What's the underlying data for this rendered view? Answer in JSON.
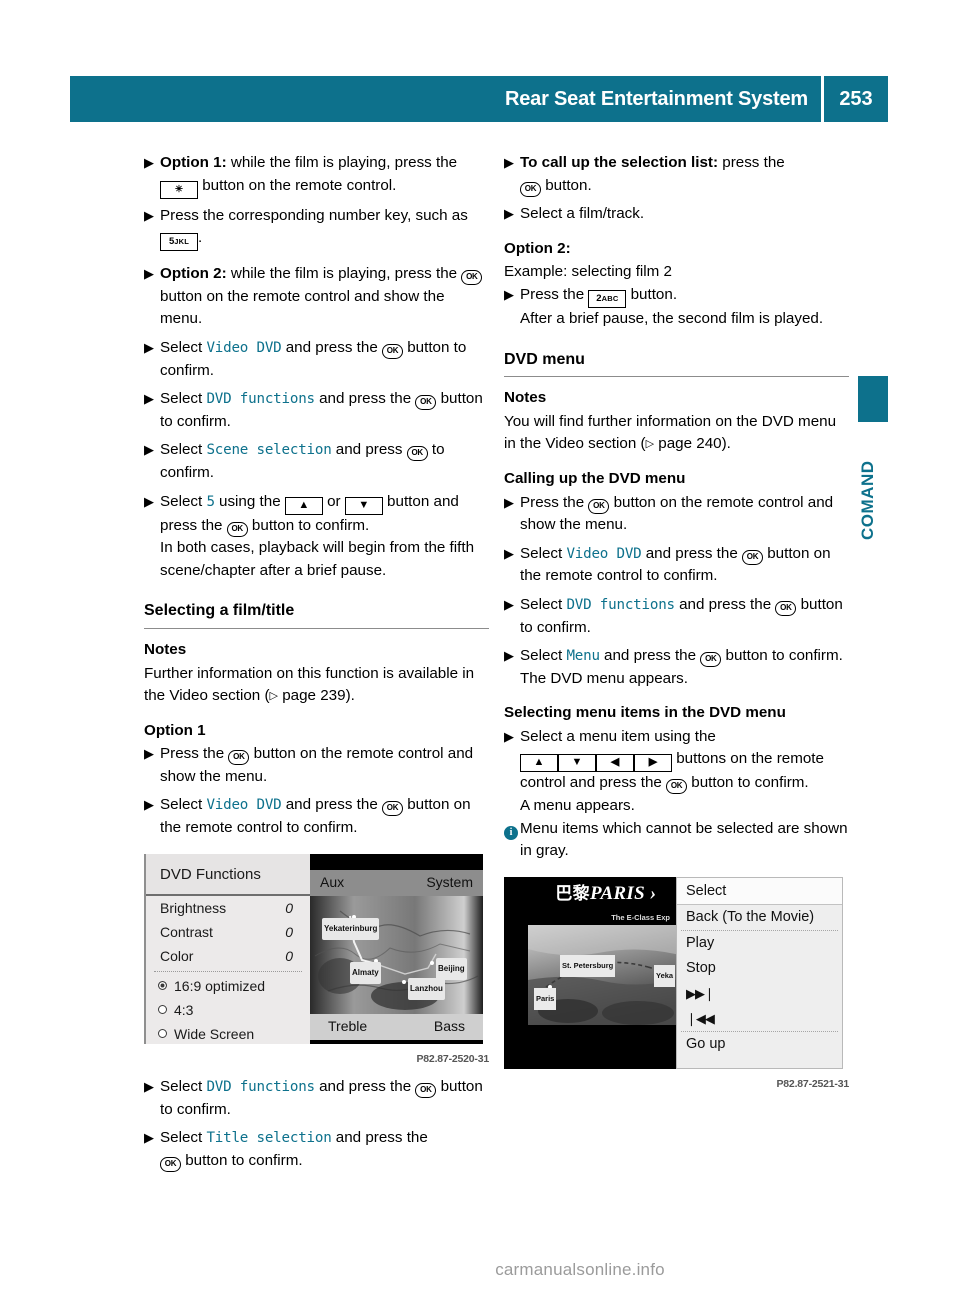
{
  "header": {
    "title": "Rear Seat Entertainment System",
    "page_number": "253"
  },
  "side_tab": {
    "label": "COMAND"
  },
  "left_column": {
    "s1": {
      "lead": "Option 1:",
      "text_a": " while the film is playing, press the ",
      "key": "✳",
      "text_b": " button on the remote control."
    },
    "s2": {
      "text_a": "Press the corresponding number key, such as ",
      "key_num": "5",
      "key_letters": "JKL",
      "text_b": "."
    },
    "s3": {
      "lead": "Option 2:",
      "text_a": " while the film is playing, press the ",
      "ok": "OK",
      "text_b": " button on the remote control and show the menu."
    },
    "s4": {
      "text_a": "Select ",
      "term": "Video DVD",
      "text_b": " and press the ",
      "ok": "OK",
      "text_c": " button to confirm."
    },
    "s5": {
      "text_a": "Select ",
      "term": "DVD functions",
      "text_b": " and press the ",
      "ok": "OK",
      "text_c": " button to confirm."
    },
    "s6": {
      "text_a": "Select ",
      "term": "Scene selection",
      "text_b": " and press ",
      "ok": "OK",
      "text_c": " to confirm."
    },
    "s7": {
      "text_a": "Select ",
      "term": "5",
      "text_b": " using the ",
      "key_up": "▲",
      "text_c": " or ",
      "key_down": "▼",
      "text_d": " button and press the ",
      "ok": "OK",
      "text_e": " button to confirm.",
      "text_f": "In both cases, playback will begin from the fifth scene/chapter after a brief pause."
    },
    "heading_film_title": "Selecting a film/title",
    "notes_heading": "Notes",
    "notes_text_a": "Further information on this function is available in the Video section (",
    "notes_ref_arrow": "▷",
    "notes_text_b": " page 239).",
    "option1_heading": "Option 1",
    "s8": {
      "text_a": "Press the ",
      "ok": "OK",
      "text_b": " button on the remote control and show the menu."
    },
    "s9": {
      "text_a": "Select ",
      "term": "Video DVD",
      "text_b": " and press the ",
      "ok": "OK",
      "text_c": " button on the remote control to confirm."
    },
    "s10": {
      "text_a": "Select ",
      "term": "DVD functions",
      "text_b": " and press the ",
      "ok": "OK",
      "text_c": " button to confirm."
    },
    "s11": {
      "text_a": "Select ",
      "term": "Title selection",
      "text_b": " and press the ",
      "ok": "OK",
      "text_c": " button to confirm."
    }
  },
  "figure_dvd_functions": {
    "caption": "P82.87-2520-31",
    "panel_title": "DVD Functions",
    "rows": [
      {
        "label": "Brightness",
        "value": "0"
      },
      {
        "label": "Contrast",
        "value": "0"
      },
      {
        "label": "Color",
        "value": "0"
      }
    ],
    "options": [
      {
        "label": "16:9 optimized",
        "selected": true
      },
      {
        "label": "4:3",
        "selected": false
      },
      {
        "label": "Wide Screen",
        "selected": false
      }
    ],
    "top_bar_left": "Aux",
    "top_bar_right": "System",
    "bottom_bar_left": "Treble",
    "bottom_bar_right": "Bass",
    "map_labels": [
      "Yekaterinburg",
      "Almaty",
      "Beijing",
      "Lanzhou"
    ]
  },
  "right_column": {
    "r1": {
      "lead": "To call up the selection list:",
      "text_a": " press the ",
      "ok": "OK",
      "text_b": " button."
    },
    "r2": {
      "text_a": "Select a film/track."
    },
    "option2_heading": "Option 2:",
    "example_line": "Example: selecting film 2",
    "r3": {
      "text_a": "Press the ",
      "key_num": "2",
      "key_letters": "ABC",
      "text_b": " button.",
      "text_c": "After a brief pause, the second film is played."
    },
    "heading_dvd_menu": "DVD menu",
    "notes_heading": "Notes",
    "notes_text_a": "You will find further information on the DVD menu in the Video section (",
    "notes_ref_arrow": "▷",
    "notes_text_b": " page 240).",
    "calling_heading": "Calling up the DVD menu",
    "r4": {
      "text_a": "Press the ",
      "ok": "OK",
      "text_b": " button on the remote control and show the menu."
    },
    "r5": {
      "text_a": "Select ",
      "term": "Video DVD",
      "text_b": " and press the ",
      "ok": "OK",
      "text_c": " button on the remote control to confirm."
    },
    "r6": {
      "text_a": "Select ",
      "term": "DVD functions",
      "text_b": " and press the ",
      "ok": "OK",
      "text_c": " button to confirm."
    },
    "r7": {
      "text_a": "Select ",
      "term": "Menu",
      "text_b": " and press the ",
      "ok": "OK",
      "text_c": " button to confirm.",
      "text_d": "The DVD menu appears."
    },
    "selecting_heading": "Selecting menu items in the DVD menu",
    "r8": {
      "text_a": "Select a menu item using the",
      "key_up": "▲",
      "key_down": "▼",
      "key_left": "◀",
      "key_right": "▶",
      "text_b": " buttons on the remote control and press the ",
      "ok": "OK",
      "text_c": " button to confirm.",
      "text_d": "A menu appears."
    },
    "info_note": {
      "icon": "i",
      "text": "Menu items which cannot be selected are shown in gray."
    }
  },
  "figure_dvd_menu": {
    "caption": "P82.87-2521-31",
    "movie_title_cjk": "巴黎",
    "movie_title_latin": "PARIS › ",
    "movie_subtitle": "The E-Class Exp",
    "map_labels": [
      "St. Petersburg",
      "Yeka",
      "Paris"
    ],
    "menu_items": [
      {
        "label": "Select",
        "is_header": true
      },
      {
        "label": "Back (To the Movie)",
        "is_header": false
      },
      {
        "label": "Play",
        "is_header": false
      },
      {
        "label": "Stop",
        "is_header": false
      },
      {
        "label": "▶▶❘",
        "is_header": false
      },
      {
        "label": "❘◀◀",
        "is_header": false
      },
      {
        "label": "Go up",
        "is_header": false
      }
    ]
  },
  "watermark": "carmanualsonline.info",
  "colors": {
    "accent_teal": "#0d718c",
    "term_teal": "#0d718c"
  }
}
